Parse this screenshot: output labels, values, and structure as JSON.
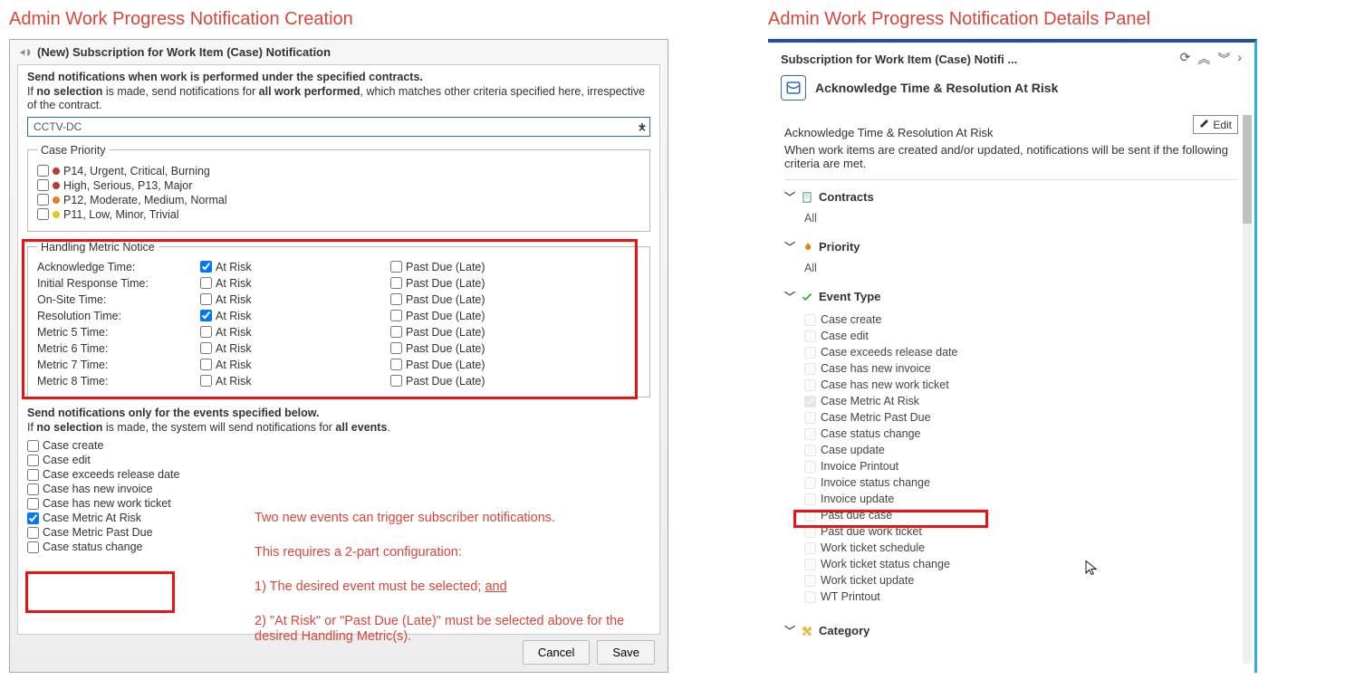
{
  "left": {
    "redTitle": "Admin Work Progress Notification Creation",
    "dialogTitle": "(New) Subscription for Work Item (Case) Notification",
    "instr1a": "Send notifications when work is performed under the specified contracts.",
    "instr1b_pre": "If ",
    "instr1b_bold": "no selection",
    "instr1b_mid": " is made, send notifications for ",
    "instr1b_bold2": "all work performed",
    "instr1b_post": ", which matches other criteria specified here, irrespective of the contract.",
    "contractValue": "CCTV-DC",
    "priorityLegend": "Case Priority",
    "priorities": [
      {
        "color": "dot-red",
        "label": "P14, Urgent, Critical, Burning"
      },
      {
        "color": "dot-red",
        "label": "High, Serious, P13, Major"
      },
      {
        "color": "dot-orange",
        "label": "P12, Moderate, Medium, Normal"
      },
      {
        "color": "dot-ylw",
        "label": "P11, Low, Minor, Trivial"
      }
    ],
    "metricLegend": "Handling Metric Notice",
    "atRisk": "At Risk",
    "pastDue": "Past Due (Late)",
    "metrics": [
      {
        "label": "Acknowledge Time:",
        "risk": true,
        "past": false
      },
      {
        "label": "Initial Response Time:",
        "risk": false,
        "past": false
      },
      {
        "label": "On-Site Time:",
        "risk": false,
        "past": false
      },
      {
        "label": "Resolution Time:",
        "risk": true,
        "past": false
      },
      {
        "label": "Metric 5 Time:",
        "risk": false,
        "past": false
      },
      {
        "label": "Metric 6 Time:",
        "risk": false,
        "past": false
      },
      {
        "label": "Metric 7 Time:",
        "risk": false,
        "past": false
      },
      {
        "label": "Metric 8 Time:",
        "risk": false,
        "past": false
      }
    ],
    "instr2a": "Send notifications only for the events specified below.",
    "instr2b_pre": "If ",
    "instr2b_bold": "no selection",
    "instr2b_mid": " is made, the system will send notifications for ",
    "instr2b_bold2": "all events",
    "instr2b_post": ".",
    "events": [
      {
        "label": "Case create",
        "checked": false
      },
      {
        "label": "Case edit",
        "checked": false
      },
      {
        "label": "Case exceeds release date",
        "checked": false
      },
      {
        "label": "Case has new invoice",
        "checked": false
      },
      {
        "label": "Case has new work ticket",
        "checked": false
      },
      {
        "label": "Case Metric At Risk",
        "checked": true
      },
      {
        "label": "Case Metric Past Due",
        "checked": false
      },
      {
        "label": "Case status change",
        "checked": false
      }
    ],
    "annot1": "Two new events can trigger subscriber notifications.",
    "annot2": "This requires a 2-part configuration:",
    "annot3_pre": "1)  The desired event must be selected; ",
    "annot3_und": "and",
    "annot4": "2)  \"At Risk\" or \"Past Due (Late)\" must be selected above for the desired Handling Metric(s).",
    "cancel": "Cancel",
    "save": "Save"
  },
  "right": {
    "redTitle": "Admin Work Progress Notification Details Panel",
    "crumb": "Subscription for Work Item (Case) Notifi ...",
    "title": "Acknowledge Time & Resolution At Risk",
    "edit": "Edit",
    "subhead": "Acknowledge Time & Resolution At Risk",
    "desc": "When work items are created and/or updated, notifications will be sent if the following criteria are met.",
    "sections": {
      "contracts": {
        "title": "Contracts",
        "body": "All"
      },
      "priority": {
        "title": "Priority",
        "body": "All"
      },
      "eventType": {
        "title": "Event Type"
      },
      "category": {
        "title": "Category"
      }
    },
    "eventTypes": [
      {
        "label": "Case create",
        "checked": false
      },
      {
        "label": "Case edit",
        "checked": false
      },
      {
        "label": "Case exceeds release date",
        "checked": false
      },
      {
        "label": "Case has new invoice",
        "checked": false
      },
      {
        "label": "Case has new work ticket",
        "checked": false
      },
      {
        "label": "Case Metric At Risk",
        "checked": true
      },
      {
        "label": "Case Metric Past Due",
        "checked": false
      },
      {
        "label": "Case status change",
        "checked": false
      },
      {
        "label": "Case update",
        "checked": false
      },
      {
        "label": "Invoice Printout",
        "checked": false
      },
      {
        "label": "Invoice status change",
        "checked": false
      },
      {
        "label": "Invoice update",
        "checked": false
      },
      {
        "label": "Past due case",
        "checked": false
      },
      {
        "label": "Past due work ticket",
        "checked": false
      },
      {
        "label": "Work ticket schedule",
        "checked": false
      },
      {
        "label": "Work ticket status change",
        "checked": false
      },
      {
        "label": "Work ticket update",
        "checked": false
      },
      {
        "label": "WT Printout",
        "checked": false
      }
    ]
  }
}
